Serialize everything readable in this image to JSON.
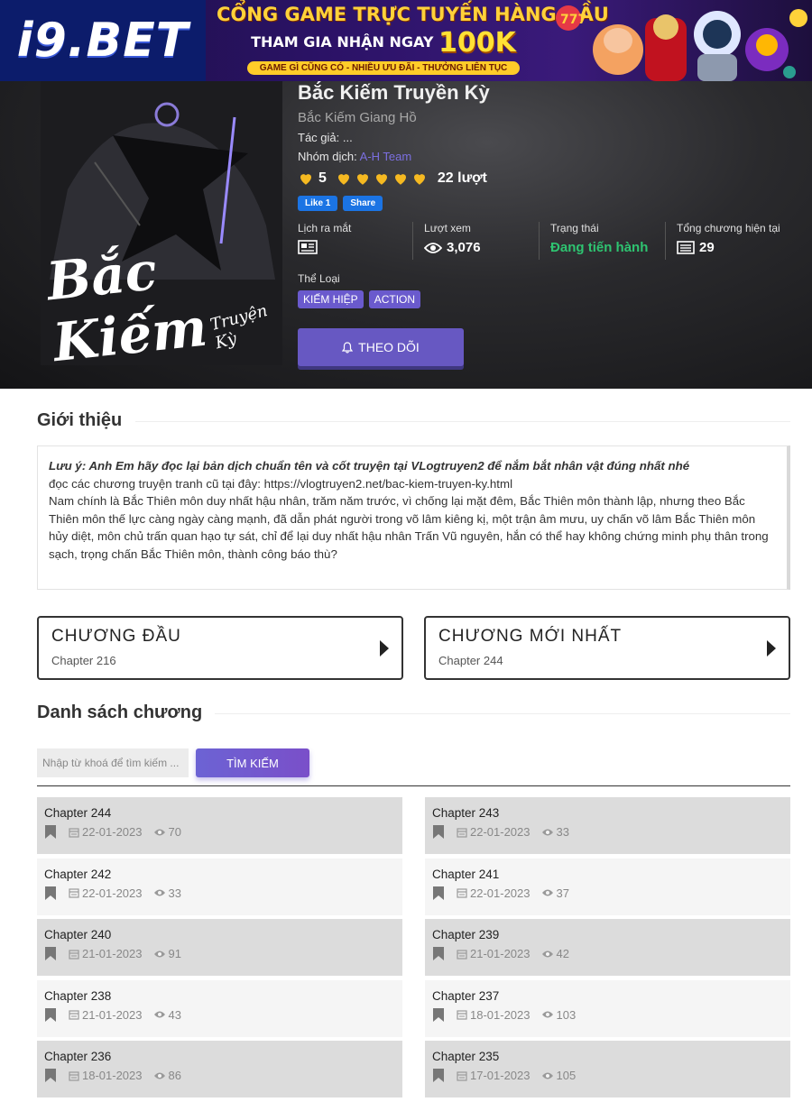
{
  "banner": {
    "logo": "i9.BET",
    "line1": "CỔNG GAME TRỰC TUYẾN HÀNG ĐẦU",
    "line2_prefix": "THAM GIA NHẬN NGAY",
    "line2_amount": "100K",
    "line3": "GAME GÌ CŨNG CÓ - NHIỀU ƯU ĐÃI - THƯỞNG LIÊN TỤC"
  },
  "cover": {
    "title": "Bắc Kiếm",
    "subtitle": "Truyện Kỳ"
  },
  "manga": {
    "title": "Bắc Kiếm Truyền Kỳ",
    "alt_title": "Bắc Kiếm Giang Hồ",
    "author_label": "Tác giả:",
    "author": "...",
    "group_label": "Nhóm dịch:",
    "group": "A-H Team",
    "rating": "5",
    "votes": "22 lượt",
    "fb_like": "Like 1",
    "fb_share": "Share"
  },
  "stats": {
    "release_label": "Lịch ra mắt",
    "views_label": "Lượt xem",
    "views": "3,076",
    "status_label": "Trạng thái",
    "status": "Đang tiến hành",
    "total_label": "Tổng chương hiện tại",
    "total": "29"
  },
  "genres_label": "Thể Loại",
  "genres": [
    "KIẾM HIỆP",
    "ACTION"
  ],
  "follow_label": "THEO DÕI",
  "intro": {
    "heading": "Giới thiệu",
    "note": "Lưu ý: Anh Em hãy đọc lại bản dịch chuẩn tên và cốt truyện tại VLogtruyen2 để nắm bắt nhân vật đúng nhất nhé",
    "old_link": "đọc các chương truyện tranh cũ tại đây: https://vlogtruyen2.net/bac-kiem-truyen-ky.html",
    "body": "Nam chính là Bắc Thiên môn duy nhất hậu nhân, trăm năm trước, vì chống lại mặt đêm, Bắc Thiên môn thành lập, nhưng theo Bắc Thiên môn thế lực càng ngày càng mạnh, đã dẫn phát người trong võ lâm kiêng kị, một trận âm mưu, uy chấn võ lâm Bắc Thiên môn hủy diệt, môn chủ trấn quan hạo tự sát, chỉ để lại duy nhất hậu nhân Trấn Vũ nguyên, hắn có thể hay không chứng minh phụ thân trong sạch, trọng chấn Bắc Thiên môn, thành công báo thù?"
  },
  "first_chapter": {
    "label": "CHƯƠNG ĐẦU",
    "chapter": "Chapter 216"
  },
  "latest_chapter": {
    "label": "CHƯƠNG MỚI NHẤT",
    "chapter": "Chapter 244"
  },
  "chapters_heading": "Danh sách chương",
  "search": {
    "placeholder": "Nhập từ khoá để tìm kiếm ...",
    "button": "TÌM KIẾM"
  },
  "chapters": [
    {
      "name": "Chapter 244",
      "date": "22-01-2023",
      "views": "70"
    },
    {
      "name": "Chapter 243",
      "date": "22-01-2023",
      "views": "33"
    },
    {
      "name": "Chapter 242",
      "date": "22-01-2023",
      "views": "33"
    },
    {
      "name": "Chapter 241",
      "date": "22-01-2023",
      "views": "37"
    },
    {
      "name": "Chapter 240",
      "date": "21-01-2023",
      "views": "91"
    },
    {
      "name": "Chapter 239",
      "date": "21-01-2023",
      "views": "42"
    },
    {
      "name": "Chapter 238",
      "date": "21-01-2023",
      "views": "43"
    },
    {
      "name": "Chapter 237",
      "date": "18-01-2023",
      "views": "103"
    },
    {
      "name": "Chapter 236",
      "date": "18-01-2023",
      "views": "86"
    },
    {
      "name": "Chapter 235",
      "date": "17-01-2023",
      "views": "105"
    }
  ],
  "colors": {
    "accent": "#6758c2",
    "status_green": "#2ec471",
    "heart": "#f5b921"
  },
  "icons": {
    "rating": "heart-icon",
    "views": "eye-icon",
    "release": "newspaper-icon",
    "total": "list-icon",
    "follow": "bell-icon",
    "bookmark": "bookmark-icon",
    "date": "calendar-icon"
  }
}
